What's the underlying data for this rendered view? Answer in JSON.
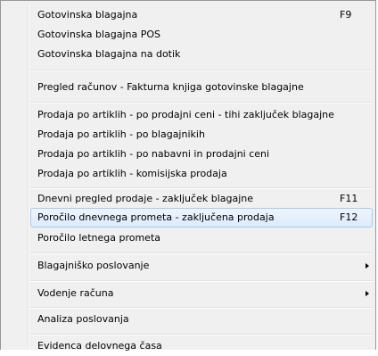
{
  "menu": {
    "items": [
      {
        "label": "Gotovinska blagajna",
        "shortcut": "F9"
      },
      {
        "label": "Gotovinska blagajna POS",
        "shortcut": ""
      },
      {
        "label": "Gotovinska blagajna na dotik",
        "shortcut": ""
      },
      {
        "label": "Pregled računov - Fakturna knjiga gotovinske blagajne",
        "shortcut": ""
      },
      {
        "label": "Prodaja po artiklih - po prodajni ceni - tihi zaključek blagajne",
        "shortcut": ""
      },
      {
        "label": "Prodaja po artiklih - po blagajnikih",
        "shortcut": ""
      },
      {
        "label": "Prodaja po artiklih - po nabavni in prodajni ceni",
        "shortcut": ""
      },
      {
        "label": "Prodaja po artiklih - komisijska prodaja",
        "shortcut": ""
      },
      {
        "label": "Dnevni pregled prodaje - zaključek blagajne",
        "shortcut": "F11"
      },
      {
        "label": "Poročilo dnevnega prometa - zaključena prodaja",
        "shortcut": "F12"
      },
      {
        "label": "Poročilo letnega prometa",
        "shortcut": ""
      },
      {
        "label": "Blagajniško poslovanje",
        "shortcut": "",
        "submenu": true
      },
      {
        "label": "Vodenje računa",
        "shortcut": "",
        "submenu": true
      },
      {
        "label": "Analiza poslovanja",
        "shortcut": ""
      },
      {
        "label": "Evidenca delovnega časa",
        "shortcut": ""
      }
    ],
    "highlighted_index": 9
  }
}
